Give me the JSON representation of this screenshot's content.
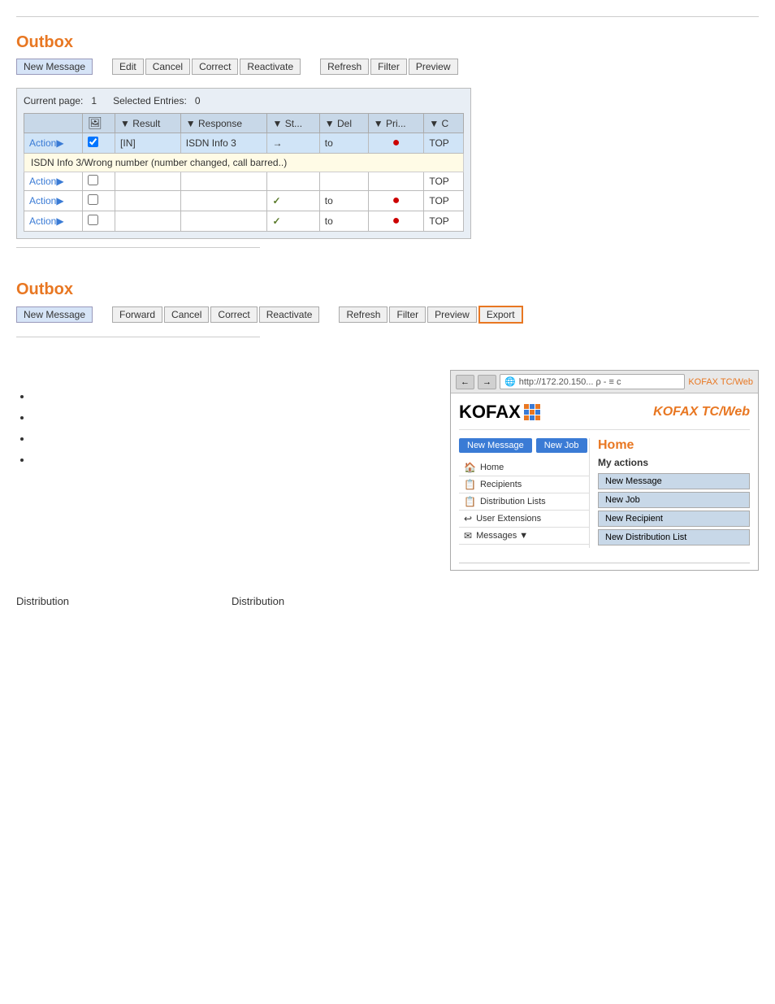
{
  "page": {
    "top_divider": true
  },
  "section1": {
    "title": "Outbox",
    "toolbar": {
      "buttons": [
        {
          "label": "New Message",
          "type": "primary"
        },
        {
          "label": "Edit",
          "type": "normal"
        },
        {
          "label": "Cancel",
          "type": "normal"
        },
        {
          "label": "Correct",
          "type": "normal"
        },
        {
          "label": "Reactivate",
          "type": "normal"
        },
        {
          "label": "Refresh",
          "type": "normal"
        },
        {
          "label": "Filter",
          "type": "normal"
        },
        {
          "label": "Preview",
          "type": "normal"
        }
      ]
    },
    "table": {
      "meta": {
        "current_page_label": "Current page:",
        "current_page_value": "1",
        "selected_label": "Selected Entries:",
        "selected_value": "0"
      },
      "columns": [
        "",
        "",
        "▼ Result",
        "▼ Response",
        "▼ St...",
        "▼ Del",
        "▼ Pri...",
        "▼ C"
      ],
      "rows": [
        {
          "id": "row1",
          "cells": [
            "Action▶",
            "",
            "[IN]",
            "ISDN Info 3",
            "→",
            "to",
            "●",
            "TOP"
          ],
          "highlighted": true,
          "has_tooltip": true,
          "tooltip": "ISDN Info 3/Wrong number (number changed, call barred..)"
        },
        {
          "id": "row2",
          "cells": [
            "Action▶",
            "",
            "",
            "",
            "",
            "",
            "",
            "TOP"
          ],
          "highlighted": false,
          "has_tooltip": false
        },
        {
          "id": "row3",
          "cells": [
            "Action▶",
            "",
            "",
            "",
            "✓",
            "to",
            "●",
            "TOP"
          ],
          "highlighted": false,
          "has_tooltip": false
        },
        {
          "id": "row4",
          "cells": [
            "Action▶",
            "",
            "",
            "",
            "✓",
            "to",
            "●",
            "TOP"
          ],
          "highlighted": false,
          "has_tooltip": false
        }
      ]
    }
  },
  "section2": {
    "title": "Outbox",
    "toolbar": {
      "buttons": [
        {
          "label": "New Message",
          "type": "primary"
        },
        {
          "label": "Forward",
          "type": "normal"
        },
        {
          "label": "Cancel",
          "type": "normal"
        },
        {
          "label": "Correct",
          "type": "normal"
        },
        {
          "label": "Reactivate",
          "type": "normal"
        },
        {
          "label": "Refresh",
          "type": "normal"
        },
        {
          "label": "Filter",
          "type": "normal"
        },
        {
          "label": "Preview",
          "type": "normal"
        },
        {
          "label": "Export",
          "type": "highlighted"
        }
      ]
    }
  },
  "section3": {
    "bullets": [
      "",
      "",
      "",
      ""
    ],
    "browser": {
      "address": "http://172.20.150... ρ - ≡ c",
      "tab": "KOFAX TC/Web",
      "logo_text": "KOFAX",
      "logo_subtitle": "KOFAX TC/Web",
      "nav_buttons": [
        "New Message",
        "New Job"
      ],
      "nav_items": [
        {
          "icon": "🏠",
          "label": "Home"
        },
        {
          "icon": "📋",
          "label": "Recipients"
        },
        {
          "icon": "📋",
          "label": "Distribution Lists"
        },
        {
          "icon": "↩",
          "label": "User Extensions"
        },
        {
          "icon": "✉",
          "label": "Messages ▼"
        }
      ],
      "home_title": "Home",
      "my_actions_title": "My actions",
      "action_buttons": [
        "New Message",
        "New Job",
        "New Recipient",
        "New Distribution List"
      ]
    }
  },
  "distribution_labels": {
    "top_label": "Distribution",
    "bottom_label": "Distribution"
  }
}
